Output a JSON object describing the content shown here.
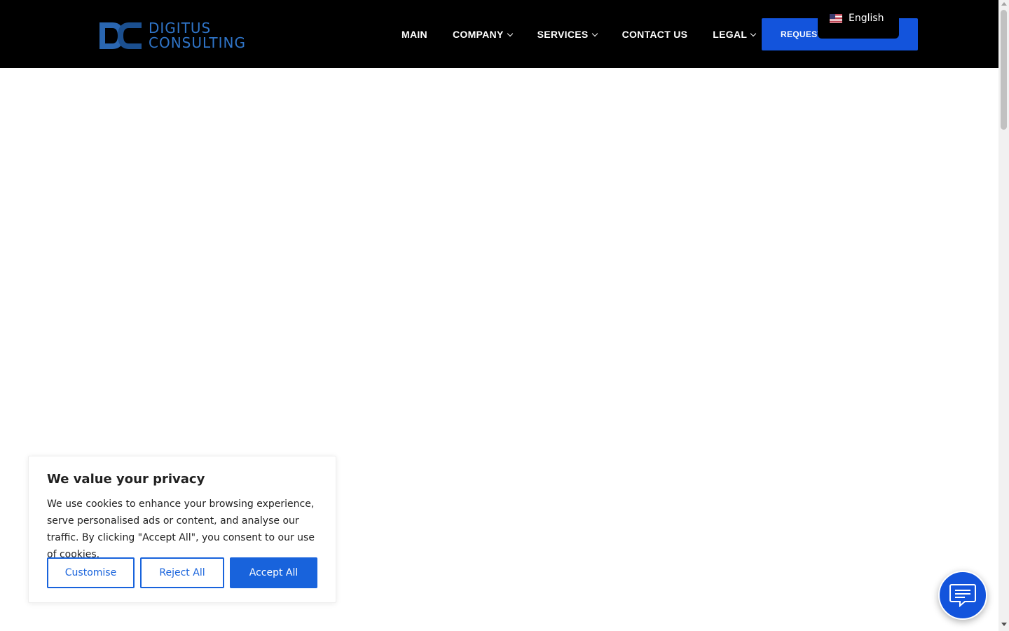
{
  "header": {
    "logo": {
      "line1": "DIGITUS",
      "line2": "CONSULTING",
      "icon": "dc-monogram-logo"
    },
    "nav": [
      {
        "label": "MAIN",
        "has_dropdown": false
      },
      {
        "label": "COMPANY",
        "has_dropdown": true
      },
      {
        "label": "SERVICES",
        "has_dropdown": true
      },
      {
        "label": "CONTACT US",
        "has_dropdown": false
      },
      {
        "label": "LEGAL",
        "has_dropdown": true
      }
    ],
    "cta_label": "REQUEST",
    "language": {
      "label": "English",
      "icon": "us-flag-icon"
    }
  },
  "cookie_banner": {
    "title": "We value your privacy",
    "text": "We use cookies to enhance your browsing experience, serve personalised ads or content, and analyse our traffic. By clicking \"Accept All\", you consent to our use of cookies.",
    "buttons": {
      "customise": "Customise",
      "reject": "Reject All",
      "accept": "Accept All"
    }
  },
  "chat_widget": {
    "icon": "chat-message-icon"
  },
  "colors": {
    "header_bg": "#000000",
    "brand_blue": "#1354dc",
    "cookie_blue": "#1863dc",
    "logo_blue": "#2f74c7"
  }
}
